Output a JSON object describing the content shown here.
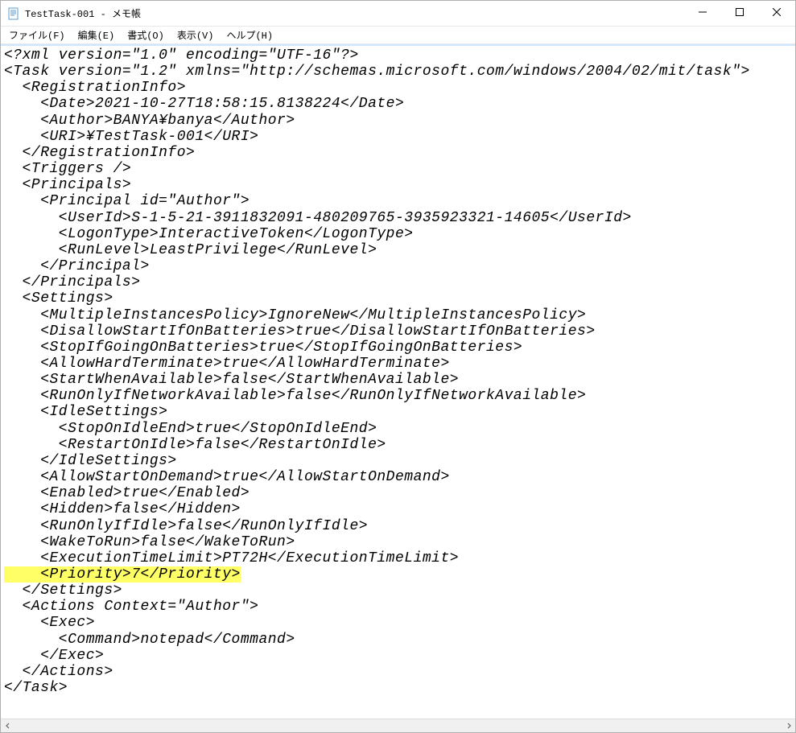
{
  "window": {
    "title": "TestTask-001 - メモ帳",
    "icon": "notepad-icon"
  },
  "menu": {
    "file": "ファイル(F)",
    "edit": "編集(E)",
    "format": "書式(O)",
    "view": "表示(V)",
    "help": "ヘルプ(H)"
  },
  "highlight_line": "    <Priority>7</Priority>",
  "xml_lines": [
    "<?xml version=\"1.0\" encoding=\"UTF-16\"?>",
    "<Task version=\"1.2\" xmlns=\"http://schemas.microsoft.com/windows/2004/02/mit/task\">",
    "  <RegistrationInfo>",
    "    <Date>2021-10-27T18:58:15.8138224</Date>",
    "    <Author>BANYA¥banya</Author>",
    "    <URI>¥TestTask-001</URI>",
    "  </RegistrationInfo>",
    "  <Triggers />",
    "  <Principals>",
    "    <Principal id=\"Author\">",
    "      <UserId>S-1-5-21-3911832091-480209765-3935923321-14605</UserId>",
    "      <LogonType>InteractiveToken</LogonType>",
    "      <RunLevel>LeastPrivilege</RunLevel>",
    "    </Principal>",
    "  </Principals>",
    "  <Settings>",
    "    <MultipleInstancesPolicy>IgnoreNew</MultipleInstancesPolicy>",
    "    <DisallowStartIfOnBatteries>true</DisallowStartIfOnBatteries>",
    "    <StopIfGoingOnBatteries>true</StopIfGoingOnBatteries>",
    "    <AllowHardTerminate>true</AllowHardTerminate>",
    "    <StartWhenAvailable>false</StartWhenAvailable>",
    "    <RunOnlyIfNetworkAvailable>false</RunOnlyIfNetworkAvailable>",
    "    <IdleSettings>",
    "      <StopOnIdleEnd>true</StopOnIdleEnd>",
    "      <RestartOnIdle>false</RestartOnIdle>",
    "    </IdleSettings>",
    "    <AllowStartOnDemand>true</AllowStartOnDemand>",
    "    <Enabled>true</Enabled>",
    "    <Hidden>false</Hidden>",
    "    <RunOnlyIfIdle>false</RunOnlyIfIdle>",
    "    <WakeToRun>false</WakeToRun>",
    "    <ExecutionTimeLimit>PT72H</ExecutionTimeLimit>",
    "__HL__",
    "  </Settings>",
    "  <Actions Context=\"Author\">",
    "    <Exec>",
    "      <Command>notepad</Command>",
    "    </Exec>",
    "  </Actions>",
    "</Task>"
  ]
}
